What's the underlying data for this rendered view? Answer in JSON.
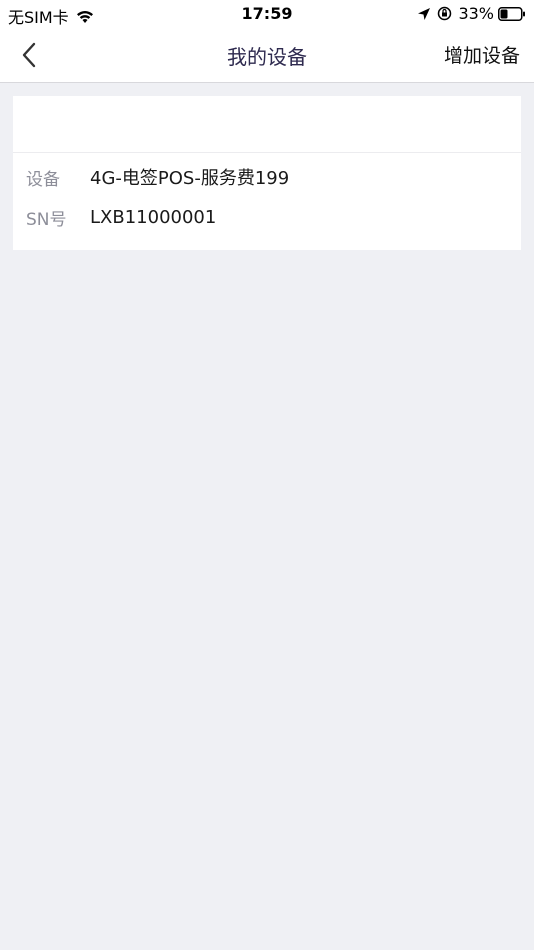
{
  "status_bar": {
    "carrier": "无SIM卡",
    "time": "17:59",
    "battery_percent": "33%"
  },
  "nav": {
    "title": "我的设备",
    "add_label": "增加设备"
  },
  "device": {
    "rows": [
      {
        "label": "设备",
        "value": "4G-电签POS-服务费199"
      },
      {
        "label": "SN号",
        "value": "LXB11000001"
      }
    ]
  },
  "colors": {
    "page_background": "#eff0f4",
    "title_color": "#2e2a4f",
    "label_color": "#8d8e99"
  }
}
